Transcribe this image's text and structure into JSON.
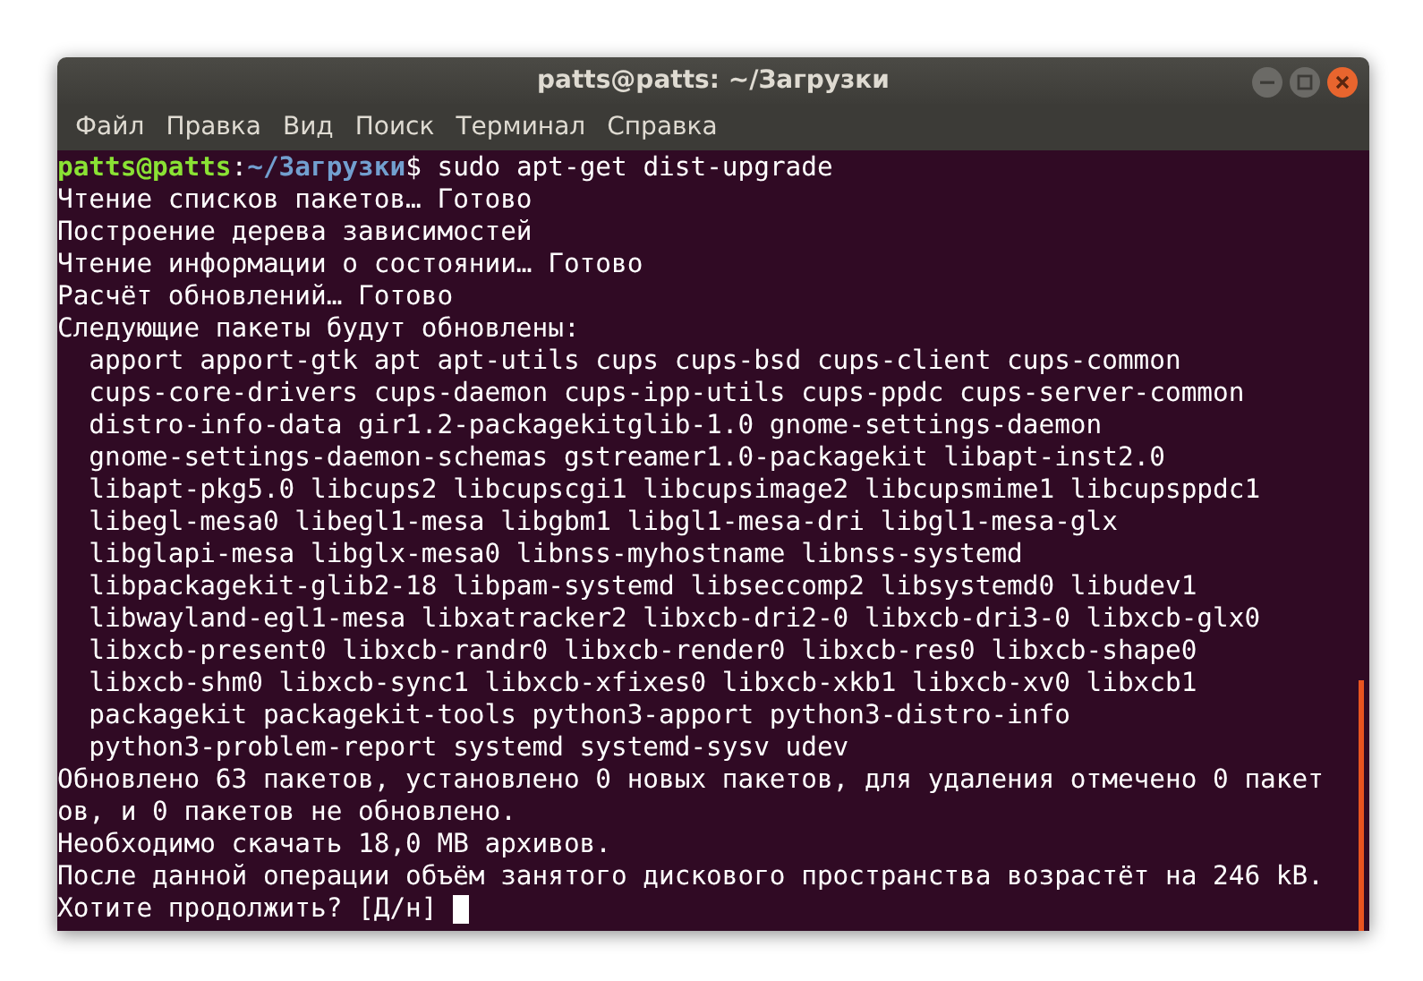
{
  "window": {
    "title": "patts@patts: ~/Загрузки"
  },
  "menu": [
    "Файл",
    "Правка",
    "Вид",
    "Поиск",
    "Терминал",
    "Справка"
  ],
  "terminal": {
    "prompt": {
      "user_host": "patts@patts",
      "separator": ":",
      "path": "~/Загрузки",
      "symbol": "$",
      "command": " sudo apt-get dist-upgrade"
    },
    "lines": [
      "Чтение списков пакетов… Готово",
      "Построение дерева зависимостей",
      "Чтение информации о состоянии… Готово",
      "Расчёт обновлений… Готово",
      "Следующие пакеты будут обновлены:",
      "  apport apport-gtk apt apt-utils cups cups-bsd cups-client cups-common",
      "  cups-core-drivers cups-daemon cups-ipp-utils cups-ppdc cups-server-common",
      "  distro-info-data gir1.2-packagekitglib-1.0 gnome-settings-daemon",
      "  gnome-settings-daemon-schemas gstreamer1.0-packagekit libapt-inst2.0",
      "  libapt-pkg5.0 libcups2 libcupscgi1 libcupsimage2 libcupsmime1 libcupsppdc1",
      "  libegl-mesa0 libegl1-mesa libgbm1 libgl1-mesa-dri libgl1-mesa-glx",
      "  libglapi-mesa libglx-mesa0 libnss-myhostname libnss-systemd",
      "  libpackagekit-glib2-18 libpam-systemd libseccomp2 libsystemd0 libudev1",
      "  libwayland-egl1-mesa libxatracker2 libxcb-dri2-0 libxcb-dri3-0 libxcb-glx0",
      "  libxcb-present0 libxcb-randr0 libxcb-render0 libxcb-res0 libxcb-shape0",
      "  libxcb-shm0 libxcb-sync1 libxcb-xfixes0 libxcb-xkb1 libxcb-xv0 libxcb1",
      "  packagekit packagekit-tools python3-apport python3-distro-info",
      "  python3-problem-report systemd systemd-sysv udev",
      "Обновлено 63 пакетов, установлено 0 новых пакетов, для удаления отмечено 0 пакет",
      "ов, и 0 пакетов не обновлено.",
      "Необходимо скачать 18,0 MB архивов.",
      "После данной операции объём занятого дискового пространства возрастёт на 246 kB."
    ],
    "input_prompt": "Хотите продолжить? [Д/н]"
  }
}
